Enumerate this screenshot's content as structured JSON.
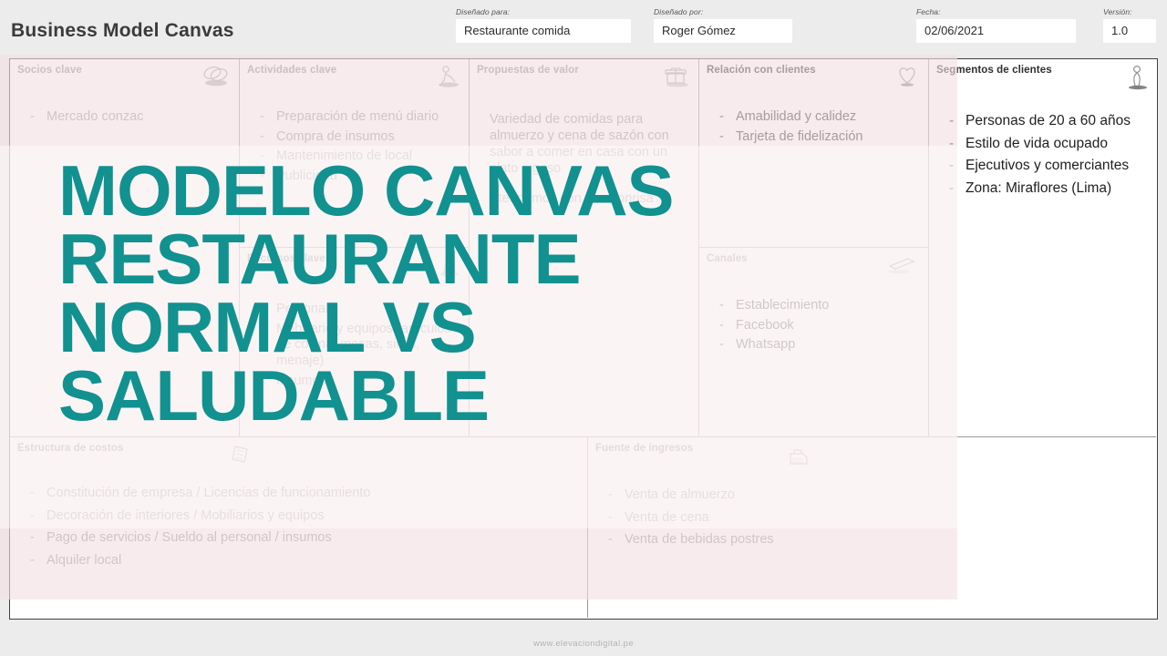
{
  "header": {
    "title": "Business Model Canvas",
    "fields": [
      {
        "label": "Diseñado para:",
        "value": "Restaurante comida"
      },
      {
        "label": "Diseñado por:",
        "value": "Roger Gómez"
      },
      {
        "label": "Fecha:",
        "value": "02/06/2021"
      },
      {
        "label": "Versión:",
        "value": "1.0"
      }
    ]
  },
  "canvas": {
    "socios_clave": {
      "title": "Socios clave",
      "icon": "chain-links-icon",
      "items": [
        "Mercado conzac"
      ]
    },
    "actividades_clave": {
      "title": "Actividades clave",
      "icon": "worker-icon",
      "items": [
        "Preparación de menú diario",
        "Compra de insumos",
        "Mantenimiento de local",
        "Publicidad"
      ]
    },
    "recursos_clave": {
      "title": "Recursos clave",
      "icon": "pawn-piece-icon",
      "items": [
        "Personal",
        "Mobiliario y equipos (artículos de cocina, mesas, sillas, menaje)",
        "Insumos"
      ]
    },
    "propuestas_de_valor": {
      "title": "Propuestas de valor",
      "icon": "gift-box-icon",
      "paragraphs": [
        "Variedad de comidas para almuerzo y cena de sazón con sabor a comer en casa con un plato jugoso",
        "Atendemos con una sonrisa"
      ]
    },
    "relacion_con_clientes": {
      "title": "Relación con clientes",
      "icon": "heart-icon",
      "items": [
        "Amabilidad y calidez",
        "Tarjeta de fidelización"
      ]
    },
    "canales": {
      "title": "Canales",
      "icon": "megaphone-icon",
      "items": [
        "Establecimiento",
        "Facebook",
        "Whatsapp"
      ]
    },
    "segmentos_de_clientes": {
      "title": "Segmentos de clientes",
      "icon": "person-icon",
      "items": [
        "Personas de 20 a 60 años",
        "Estilo de vida ocupado",
        "Ejecutivos y comerciantes",
        "Zona: Miraflores (Lima)"
      ]
    },
    "estructura_de_costos": {
      "title": "Estructura de costos",
      "icon": "note-paper-icon",
      "items": [
        "Constitución de empresa / Licencias de funcionamiento",
        "Decoración de interiores / Mobiliarios y equipos",
        "Pago de servicios / Sueldo al personal / insumos",
        "Alquiler local"
      ]
    },
    "fuente_de_ingresos": {
      "title": "Fuente de ingresos",
      "icon": "cash-register-icon",
      "items": [
        "Venta de almuerzo",
        "Venta de cena",
        "Venta de bebidas postres"
      ]
    }
  },
  "overlay": {
    "lines": [
      "MODELO CANVAS",
      "RESTAURANTE",
      "NORMAL VS",
      "SALUDABLE"
    ],
    "color": "#11918f"
  },
  "footer": {
    "url": "www.elevaciondigital.pe"
  }
}
